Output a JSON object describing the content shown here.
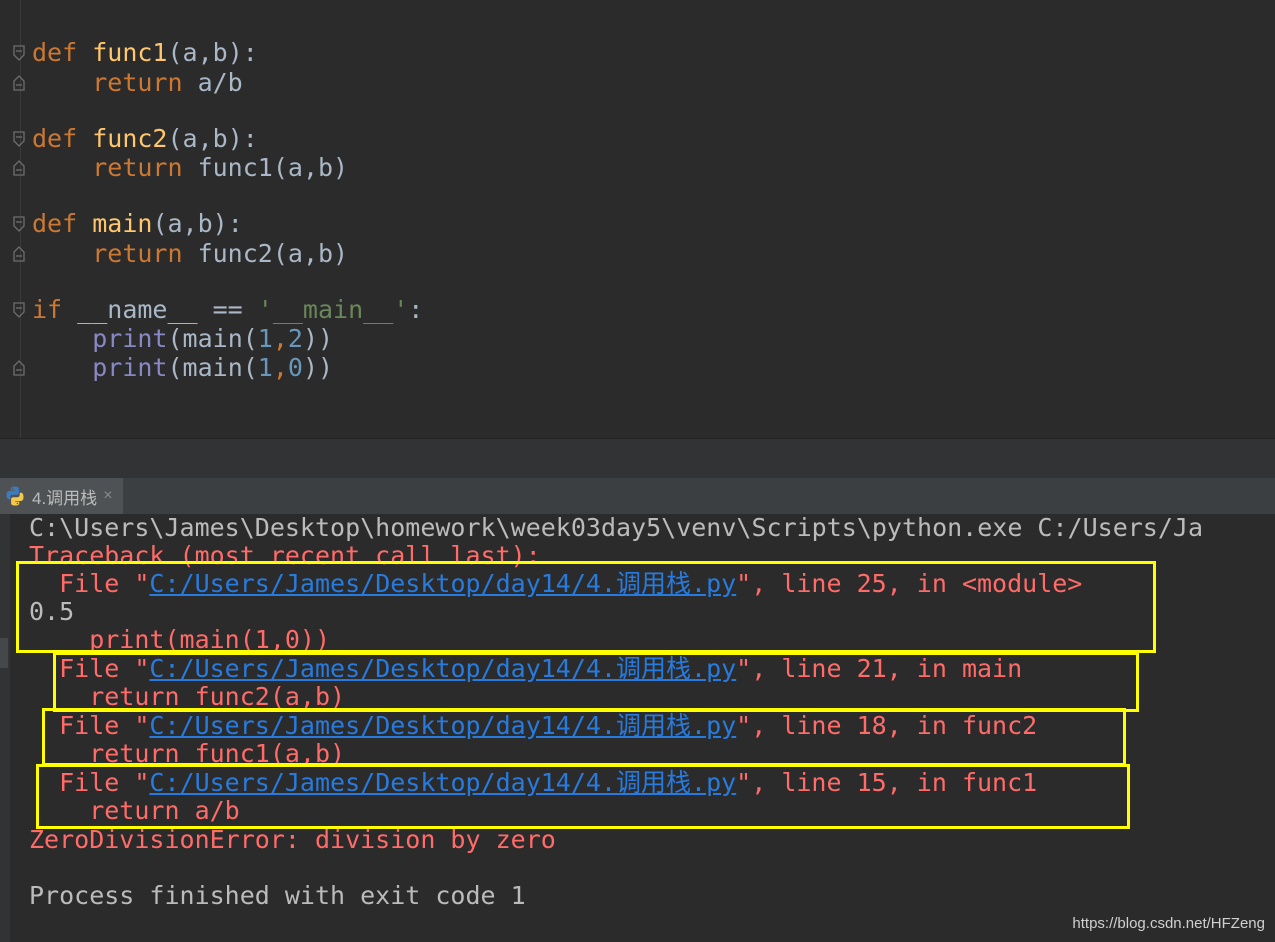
{
  "editor": {
    "lines": [
      {
        "kw": "def",
        "sp1": " ",
        "name": "func1",
        "args": "(a,b):"
      },
      {
        "indent": "    ",
        "kw": "return",
        "rest": " a/b"
      },
      {
        "kw": "def",
        "sp1": " ",
        "name": "func2",
        "args": "(a,b):"
      },
      {
        "indent": "    ",
        "kw": "return",
        "rest": " func1(a,b)"
      },
      {
        "kw": "def",
        "sp1": " ",
        "name": "main",
        "args": "(a,b):"
      },
      {
        "indent": "    ",
        "kw": "return",
        "rest": " func2(a,b)"
      },
      {
        "kw": "if",
        "rest": " __name__ == ",
        "str": "'__main__'",
        "colon": ":"
      },
      {
        "indent": "    ",
        "fn": "print",
        "open": "(main(",
        "n1": "1",
        "comma": ",",
        "n2": "2",
        "close": "))"
      },
      {
        "indent": "    ",
        "fn": "print",
        "open": "(main(",
        "n1": "1",
        "comma": ",",
        "n2": "0",
        "close": "))"
      }
    ]
  },
  "run_tab": {
    "label": "4.调用栈",
    "close": "×",
    "icon": "python-icon"
  },
  "console": {
    "command": "C:\\Users\\James\\Desktop\\homework\\week03day5\\venv\\Scripts\\python.exe C:/Users/Ja",
    "traceback_header": "Traceback (most recent call last):",
    "frames": [
      {
        "prefix": "  File \"",
        "path": "C:/Users/James/Desktop/day14/4.调用栈.py",
        "suffix": "\", line 25, in <module>",
        "code": "    print(main(1,0))"
      },
      {
        "prefix": "  File \"",
        "path": "C:/Users/James/Desktop/day14/4.调用栈.py",
        "suffix": "\", line 21, in main",
        "code": "    return func2(a,b)"
      },
      {
        "prefix": "  File \"",
        "path": "C:/Users/James/Desktop/day14/4.调用栈.py",
        "suffix": "\", line 18, in func2",
        "code": "    return func1(a,b)"
      },
      {
        "prefix": "  File \"",
        "path": "C:/Users/James/Desktop/day14/4.调用栈.py",
        "suffix": "\", line 15, in func1",
        "code": "    return a/b"
      }
    ],
    "output_value": "0.5",
    "error": "ZeroDivisionError: division by zero",
    "exit_message": "Process finished with exit code 1"
  },
  "watermark": "https://blog.csdn.net/HFZeng",
  "colors": {
    "highlight_box": "#ffff00",
    "error": "#ff6b68",
    "link": "#287bde",
    "keyword": "#cc7832"
  }
}
